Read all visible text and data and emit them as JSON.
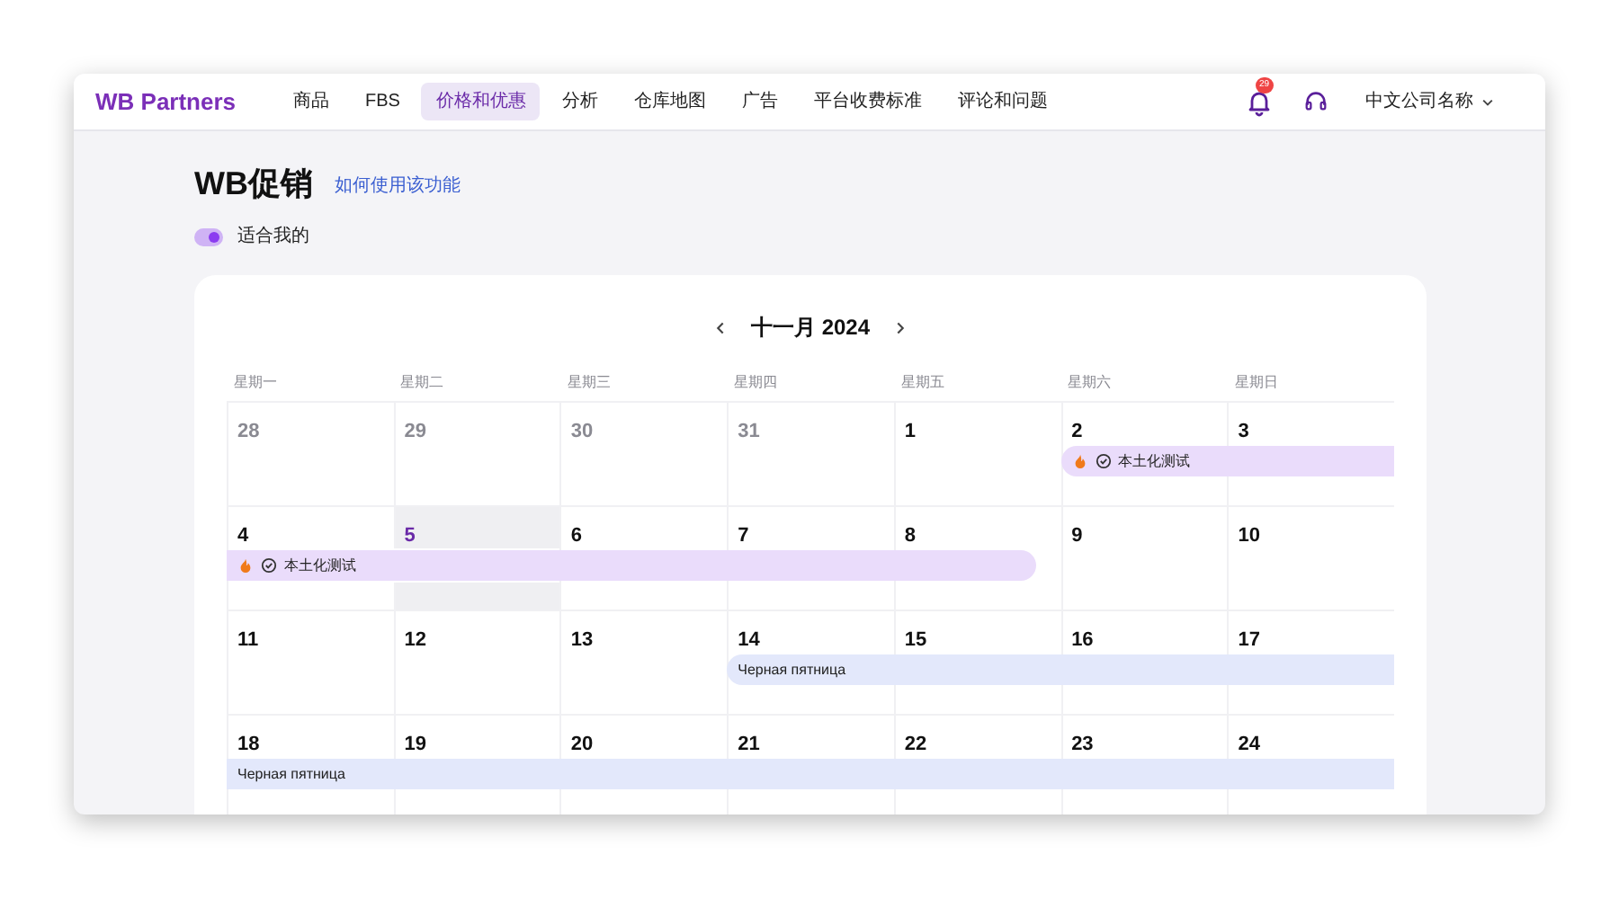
{
  "nav": {
    "logo": "WB Partners",
    "items": [
      {
        "label": "商品",
        "selected": false
      },
      {
        "label": "FBS",
        "selected": false
      },
      {
        "label": "价格和优惠",
        "selected": true
      },
      {
        "label": "分析",
        "selected": false
      },
      {
        "label": "仓库地图",
        "selected": false
      },
      {
        "label": "广告",
        "selected": false
      },
      {
        "label": "平台收费标准",
        "selected": false
      },
      {
        "label": "评论和问题",
        "selected": false
      }
    ],
    "notification_count": "29",
    "account": "中文公司名称"
  },
  "page": {
    "title": "WB促销",
    "help_link": "如何使用该功能",
    "filter": {
      "label": "适合我的",
      "on": true
    }
  },
  "calendar": {
    "month": "十一月 2024",
    "weekdays": [
      "星期一",
      "星期二",
      "星期三",
      "星期四",
      "星期五",
      "星期六",
      "星期日"
    ],
    "weeks": [
      {
        "runs": [
          {
            "days": [
              {
                "date": "28",
                "other_month": true,
                "today": false
              },
              {
                "date": "29",
                "other_month": true,
                "today": false
              },
              {
                "date": "30",
                "other_month": true,
                "today": false
              },
              {
                "date": "31",
                "other_month": true,
                "today": false
              },
              {
                "date": "1",
                "other_month": false,
                "today": false
              }
            ]
          },
          {
            "days": [
              {
                "date": "2",
                "other_month": false,
                "today": false
              },
              {
                "date": "3",
                "other_month": false,
                "today": false
              }
            ],
            "event": {
              "label": "本土化测试",
              "kind": "promo",
              "starts": true,
              "ends": false
            }
          }
        ]
      },
      {
        "runs": [
          {
            "days": [
              {
                "date": "4",
                "other_month": false,
                "today": false
              },
              {
                "date": "5",
                "other_month": false,
                "today": true
              },
              {
                "date": "6",
                "other_month": false,
                "today": false
              },
              {
                "date": "7",
                "other_month": false,
                "today": false
              },
              {
                "date": "8",
                "other_month": false,
                "today": false
              }
            ],
            "event": {
              "label": "本土化测试",
              "kind": "promo",
              "starts": false,
              "ends": true
            }
          },
          {
            "days": [
              {
                "date": "9",
                "other_month": false,
                "today": false
              },
              {
                "date": "10",
                "other_month": false,
                "today": false
              }
            ]
          }
        ]
      },
      {
        "runs": [
          {
            "days": [
              {
                "date": "11",
                "other_month": false,
                "today": false
              },
              {
                "date": "12",
                "other_month": false,
                "today": false
              },
              {
                "date": "13",
                "other_month": false,
                "today": false
              }
            ]
          },
          {
            "days": [
              {
                "date": "14",
                "other_month": false,
                "today": false
              },
              {
                "date": "15",
                "other_month": false,
                "today": false
              },
              {
                "date": "16",
                "other_month": false,
                "today": false
              },
              {
                "date": "17",
                "other_month": false,
                "today": false
              }
            ],
            "event": {
              "label": "Черная пятница",
              "kind": "sale",
              "starts": true,
              "ends": false
            }
          }
        ]
      },
      {
        "runs": [
          {
            "days": [
              {
                "date": "18",
                "other_month": false,
                "today": false
              },
              {
                "date": "19",
                "other_month": false,
                "today": false
              },
              {
                "date": "20",
                "other_month": false,
                "today": false
              },
              {
                "date": "21",
                "other_month": false,
                "today": false
              },
              {
                "date": "22",
                "other_month": false,
                "today": false
              },
              {
                "date": "23",
                "other_month": false,
                "today": false
              },
              {
                "date": "24",
                "other_month": false,
                "today": false
              }
            ],
            "event": {
              "label": "Черная пятница",
              "kind": "sale",
              "starts": false,
              "ends": false
            }
          }
        ]
      }
    ]
  }
}
